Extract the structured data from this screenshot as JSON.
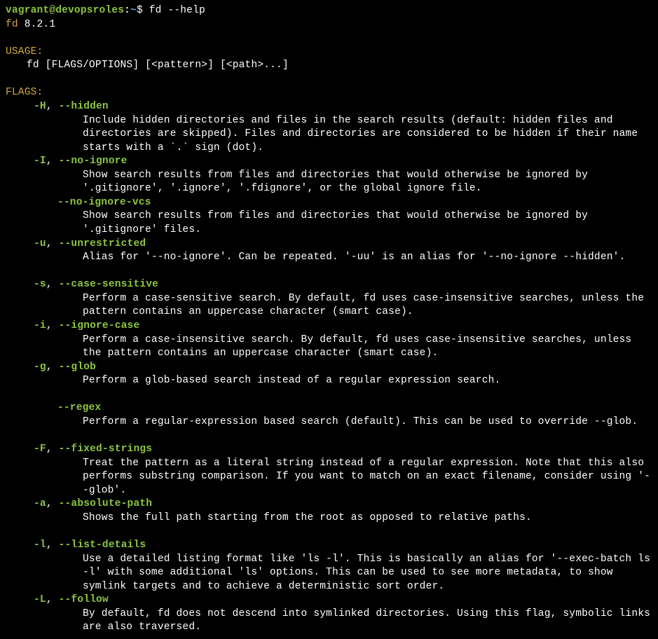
{
  "prompt": {
    "user": "vagrant",
    "at": "@",
    "host": "devopsroles",
    "colon": ":",
    "path": "~",
    "dollar": "$",
    "command": "fd --help"
  },
  "program": {
    "name": "fd",
    "version": "8.2.1"
  },
  "sections": {
    "usage": {
      "header": "USAGE:",
      "text": "fd [FLAGS/OPTIONS] [<pattern>] [<path>...]"
    },
    "flags": {
      "header": "FLAGS:",
      "items": [
        {
          "short": "-H",
          "long": "--hidden",
          "desc": "Include hidden directories and files in the search results (default: hidden files and directories are skipped). Files and directories are considered to be hidden if their name starts with a `.` sign (dot)."
        },
        {
          "short": "-I",
          "long": "--no-ignore",
          "desc": "Show search results from files and directories that would otherwise be ignored by '.gitignore', '.ignore', '.fdignore', or the global ignore file."
        },
        {
          "short": "",
          "long": "--no-ignore-vcs",
          "desc": "Show search results from files and directories that would otherwise be ignored by '.gitignore' files."
        },
        {
          "short": "-u",
          "long": "--unrestricted",
          "desc": "Alias for '--no-ignore'. Can be repeated. '-uu' is an alias for '--no-ignore --hidden'.",
          "gapAfter": true
        },
        {
          "short": "-s",
          "long": "--case-sensitive",
          "desc": "Perform a case-sensitive search. By default, fd uses case-insensitive searches, unless the pattern contains an uppercase character (smart case)."
        },
        {
          "short": "-i",
          "long": "--ignore-case",
          "desc": "Perform a case-insensitive search. By default, fd uses case-insensitive searches, unless the pattern contains an uppercase character (smart case)."
        },
        {
          "short": "-g",
          "long": "--glob",
          "desc": "Perform a glob-based search instead of a regular expression search.",
          "gapAfter": true
        },
        {
          "short": "",
          "long": "--regex",
          "desc": "Perform a regular-expression based search (default). This can be used to override --glob.",
          "gapAfter": true
        },
        {
          "short": "-F",
          "long": "--fixed-strings",
          "desc": "Treat the pattern as a literal string instead of a regular expression. Note that this also performs substring comparison. If you want to match on an exact filename, consider using '--glob'."
        },
        {
          "short": "-a",
          "long": "--absolute-path",
          "desc": "Shows the full path starting from the root as opposed to relative paths.",
          "gapAfter": true
        },
        {
          "short": "-l",
          "long": "--list-details",
          "desc": "Use a detailed listing format like 'ls -l'. This is basically an alias for '--exec-batch ls -l' with some additional 'ls' options. This can be used to see more metadata, to show symlink targets and to achieve a deterministic sort order."
        },
        {
          "short": "-L",
          "long": "--follow",
          "desc": "By default, fd does not descend into symlinked directories. Using this flag, symbolic links are also traversed."
        }
      ]
    }
  }
}
